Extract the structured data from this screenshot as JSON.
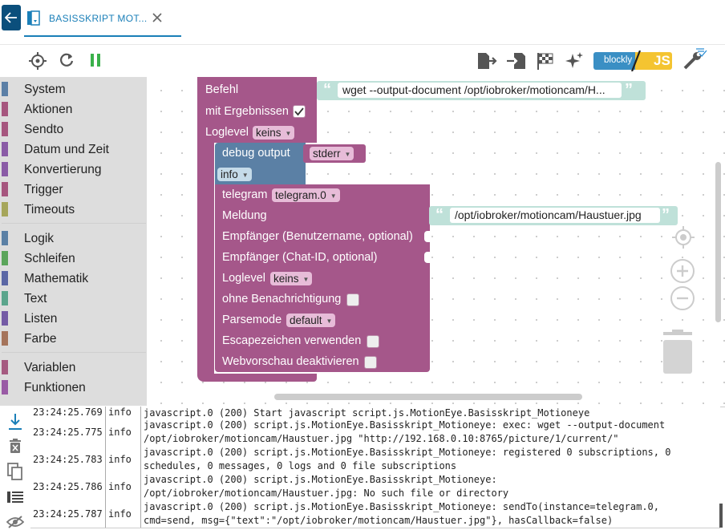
{
  "tab": {
    "title": "BASISSKRIPT MOT...",
    "back_icon": "arrow-left-icon",
    "script_icon": "script-file-icon",
    "close_icon": "close-icon"
  },
  "toolbar": {
    "left_icons": [
      "crosshair-icon",
      "restart-icon",
      "pause-icon"
    ],
    "right_icons": [
      "export-icon",
      "import-icon",
      "flag-icon",
      "magic-icon"
    ],
    "blockly_label": "blockly",
    "js_label": "JS",
    "settings_icon": "wrench-icon"
  },
  "sidebar": {
    "groups": [
      [
        {
          "label": "System",
          "color": "#5b7fa6"
        },
        {
          "label": "Aktionen",
          "color": "#a6567e"
        },
        {
          "label": "Sendto",
          "color": "#a6567e"
        },
        {
          "label": "Datum und Zeit",
          "color": "#8a5ba6"
        },
        {
          "label": "Konvertierung",
          "color": "#8a5ba6"
        },
        {
          "label": "Trigger",
          "color": "#a6567e"
        },
        {
          "label": "Timeouts",
          "color": "#a6a65b"
        }
      ],
      [
        {
          "label": "Logik",
          "color": "#5b80a5"
        },
        {
          "label": "Schleifen",
          "color": "#5ba55b"
        },
        {
          "label": "Mathematik",
          "color": "#5b67a5"
        },
        {
          "label": "Text",
          "color": "#5ba58c"
        },
        {
          "label": "Listen",
          "color": "#745ba5"
        },
        {
          "label": "Farbe",
          "color": "#a5745b"
        }
      ],
      [
        {
          "label": "Variablen",
          "color": "#a55b80"
        },
        {
          "label": "Funktionen",
          "color": "#995ba5"
        }
      ]
    ]
  },
  "blocks": {
    "exec": {
      "command_label": "Befehl",
      "command_value": "wget --output-document /opt/iobroker/motioncam/H...",
      "with_result_label": "mit Ergebnissen",
      "with_result_checked": true,
      "loglevel_label": "Loglevel",
      "loglevel_value": "keins"
    },
    "debug": {
      "label": "debug output",
      "target_value": "stderr",
      "level_value": "info"
    },
    "telegram": {
      "label": "telegram",
      "instance_value": "telegram.0",
      "message_label": "Meldung",
      "message_value": "/opt/iobroker/motioncam/Haustuer.jpg",
      "recipient_user_label": "Empfänger (Benutzername, optional)",
      "recipient_chat_label": "Empfänger (Chat-ID, optional)",
      "loglevel_label": "Loglevel",
      "loglevel_value": "keins",
      "silent_label": "ohne Benachrichtigung",
      "parsemode_label": "Parsemode",
      "parsemode_value": "default",
      "escape_label": "Escapezeichen verwenden",
      "preview_label": "Webvorschau deaktivieren"
    }
  },
  "workspace_controls": [
    "center-icon",
    "zoom-in-icon",
    "zoom-out-icon",
    "trash-icon"
  ],
  "log": {
    "tool_icons": [
      "scroll-down-icon",
      "delete-icon",
      "copy-icon",
      "list-icon",
      "hide-icon"
    ],
    "rows": [
      {
        "time": "23:24:25.769",
        "severity": "info",
        "message": "javascript.0 (200) Start javascript script.js.MotionEye.Basisskript_Motioneye"
      },
      {
        "time": "23:24:25.775",
        "severity": "info",
        "message": "javascript.0 (200) script.js.MotionEye.Basisskript_Motioneye: exec: wget --output-document /opt/iobroker/motioncam/Haustuer.jpg \"http://192.168.0.10:8765/picture/1/current/\""
      },
      {
        "time": "23:24:25.783",
        "severity": "info",
        "message": "javascript.0 (200) script.js.MotionEye.Basisskript_Motioneye: registered 0 subscriptions, 0 schedules, 0 messages, 0 logs and 0 file subscriptions"
      },
      {
        "time": "23:24:25.786",
        "severity": "info",
        "message": "javascript.0 (200) script.js.MotionEye.Basisskript_Motioneye: /opt/iobroker/motioncam/Haustuer.jpg: No such file or directory"
      },
      {
        "time": "23:24:25.787",
        "severity": "info",
        "message": "javascript.0 (200) script.js.MotionEye.Basisskript_Motioneye: sendTo(instance=telegram.0, cmd=send, msg={\"text\":\"/opt/iobroker/motioncam/Haustuer.jpg\"}, hasCallback=false)"
      }
    ]
  }
}
